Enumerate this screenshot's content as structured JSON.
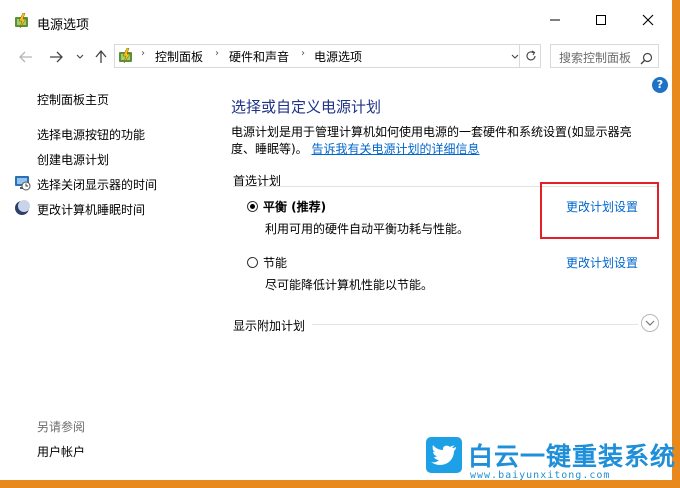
{
  "window": {
    "title": "电源选项"
  },
  "address": {
    "breadcrumbs": [
      "控制面板",
      "硬件和声音",
      "电源选项"
    ],
    "search_placeholder": "搜索控制面板"
  },
  "sidebar": {
    "home": "控制面板主页",
    "items": [
      {
        "label": "选择电源按钮的功能"
      },
      {
        "label": "创建电源计划"
      },
      {
        "label": "选择关闭显示器的时间",
        "icon": "display-timer-icon"
      },
      {
        "label": "更改计算机睡眠时间",
        "icon": "moon-sleep-icon"
      }
    ],
    "see_also_label": "另请参阅",
    "see_also_items": [
      {
        "label": "用户帐户"
      }
    ]
  },
  "main": {
    "title": "选择或自定义电源计划",
    "description": "电源计划是用于管理计算机如何使用电源的一套硬件和系统设置(如显示器亮度、睡眠等)。",
    "more_link": "告诉我有关电源计划的详细信息",
    "preferred_label": "首选计划",
    "plans": [
      {
        "name": "平衡 (推荐)",
        "desc": "利用可用的硬件自动平衡功耗与性能。",
        "selected": true,
        "change_label": "更改计划设置"
      },
      {
        "name": "节能",
        "desc": "尽可能降低计算机性能以节能。",
        "selected": false,
        "change_label": "更改计划设置"
      }
    ],
    "extra_plans_label": "显示附加计划"
  },
  "help": {
    "label": "?"
  },
  "watermark": {
    "title": "白云一键重装系统",
    "url": "www.baiyunxitong.com"
  },
  "colors": {
    "link": "#0066cc",
    "title": "#1e3287",
    "highlight": "#e32026",
    "watermark": "#1e8fd8"
  }
}
